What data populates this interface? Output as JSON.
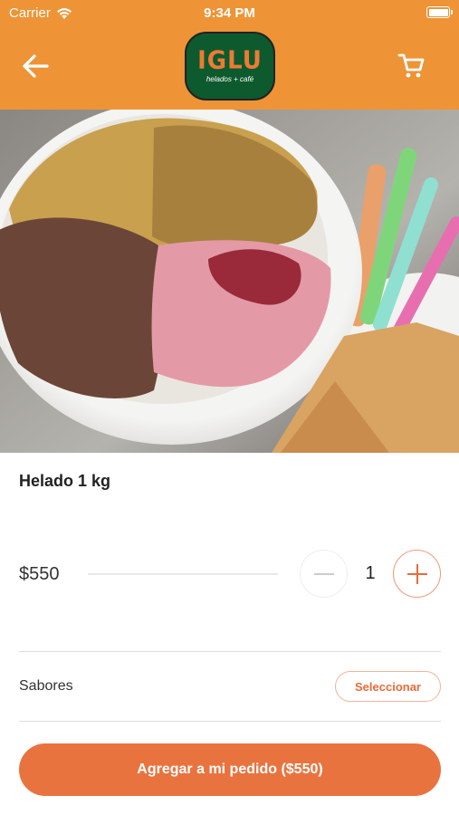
{
  "status_bar": {
    "carrier": "Carrier",
    "time": "9:34 PM"
  },
  "header": {
    "logo_word": "IGLU",
    "logo_tagline": "helados + café",
    "back_icon": "arrow-left-icon",
    "cart_icon": "cart-icon"
  },
  "hero": {
    "image": "ice-cream-bucket-photo"
  },
  "product": {
    "name": "Helado 1 kg",
    "price": "$550",
    "quantity": "1"
  },
  "options": {
    "label": "Sabores",
    "select_label": "Seleccionar"
  },
  "cta": {
    "label": "Agregar a mi pedido ($550)"
  },
  "colors": {
    "header": "#ee9436",
    "accent": "#e9733f",
    "logo_bg": "#0e5a2f"
  }
}
